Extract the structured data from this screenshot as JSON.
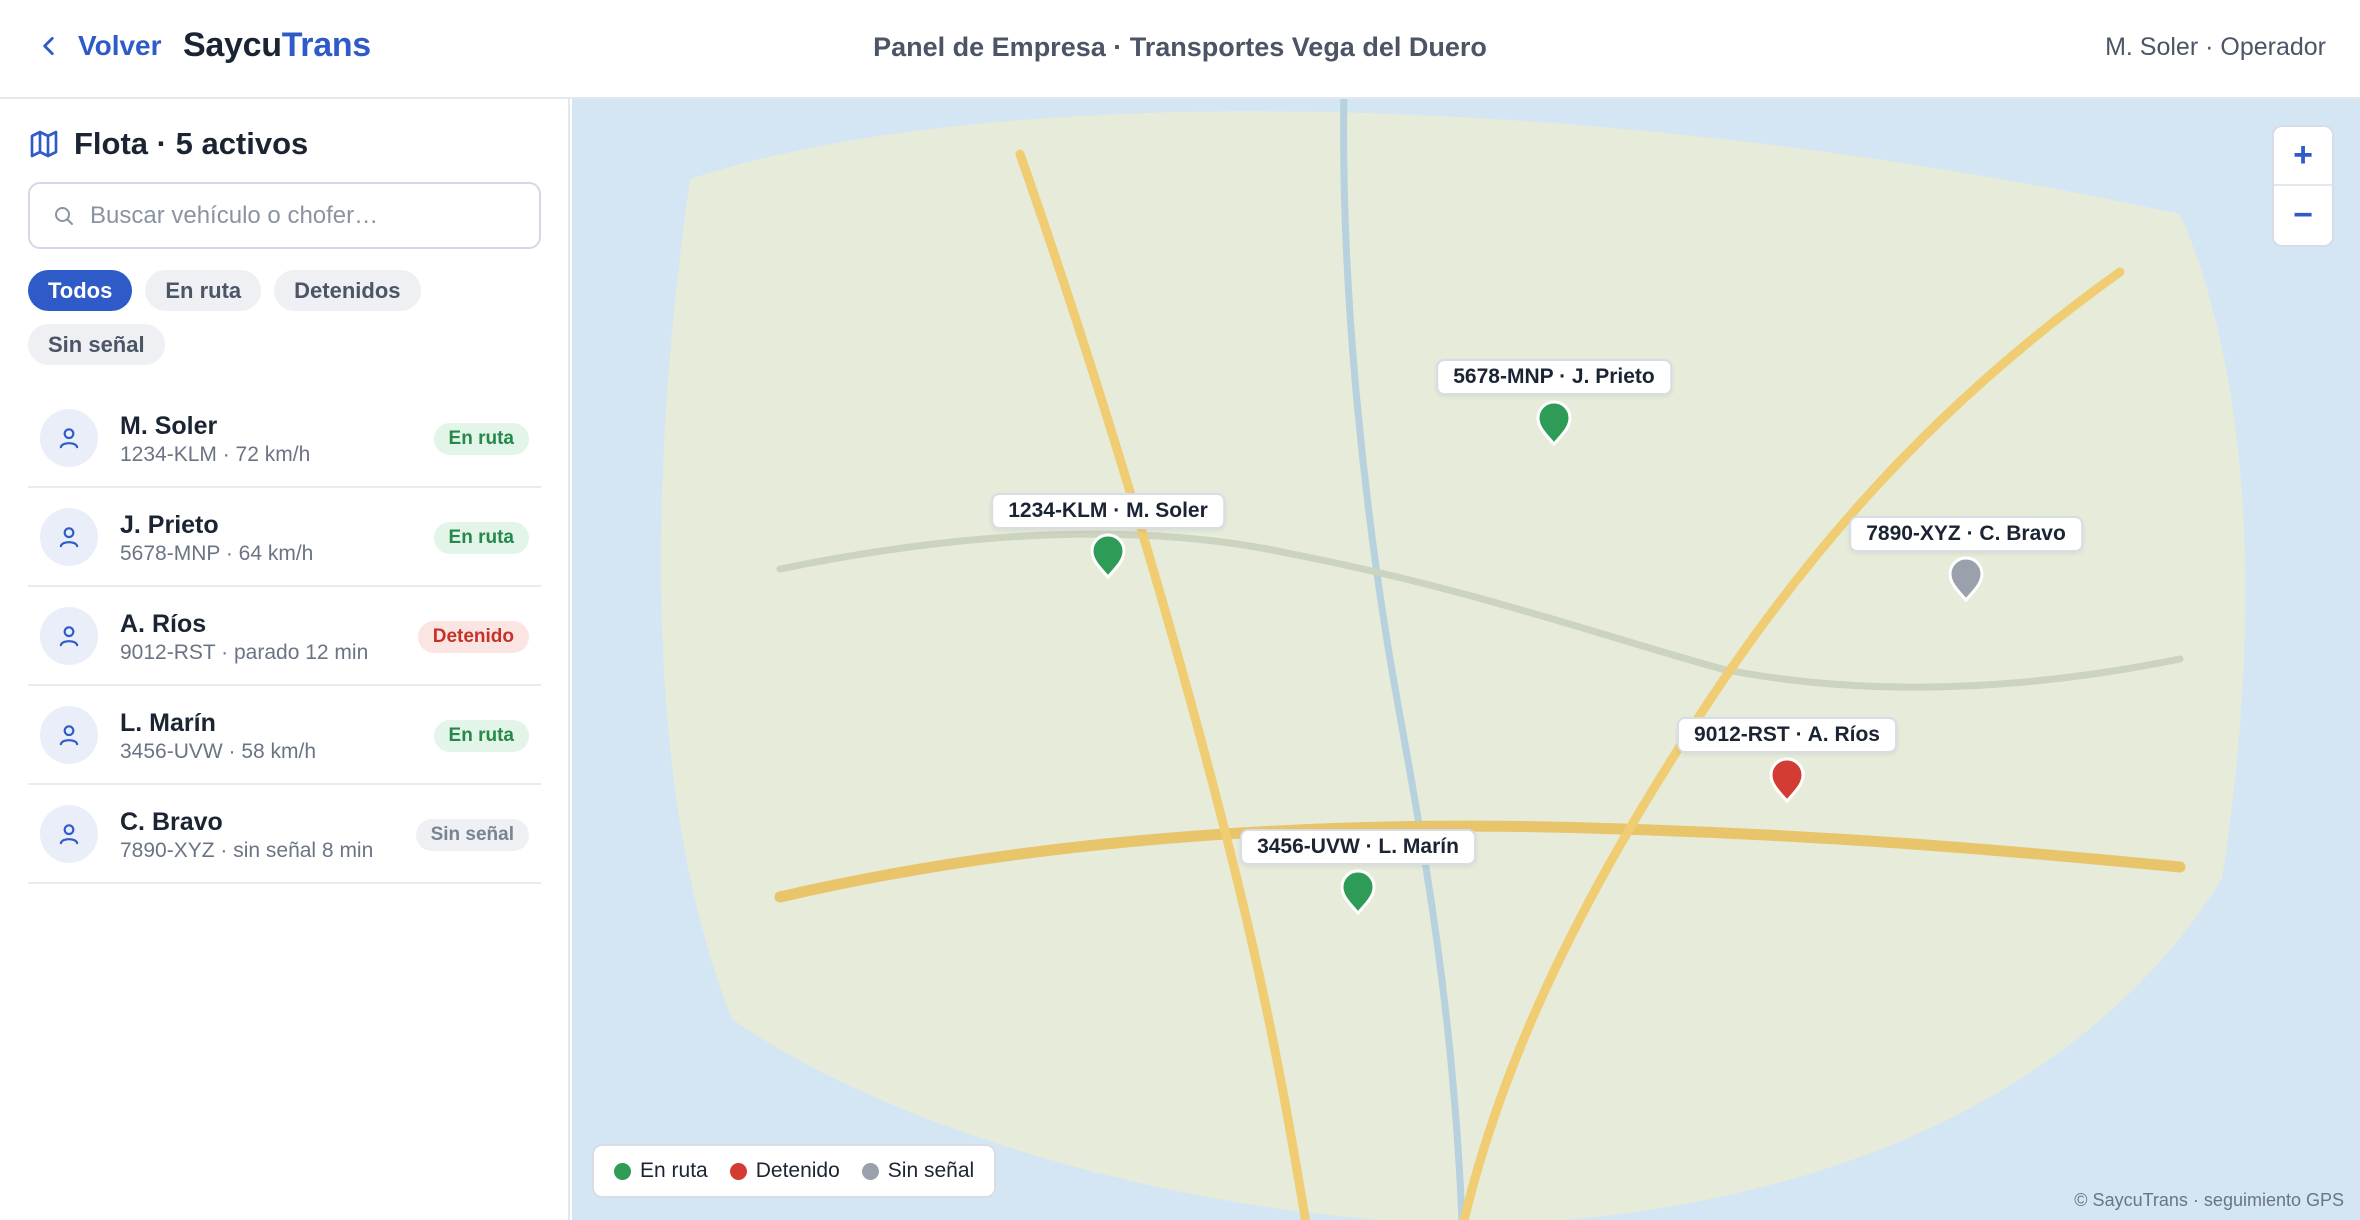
{
  "header": {
    "back_label": "Volver",
    "brand_part1": "Saycu",
    "brand_part2": "Trans",
    "title": "Panel de Empresa · Transportes Vega del Duero",
    "user": "M. Soler · Operador"
  },
  "sidebar": {
    "title": "Flota · 5 activos",
    "search_placeholder": "Buscar vehículo o chofer…",
    "filters": [
      {
        "label": "Todos",
        "active": true
      },
      {
        "label": "En ruta",
        "active": false
      },
      {
        "label": "Detenidos",
        "active": false
      },
      {
        "label": "Sin señal",
        "active": false
      }
    ],
    "drivers": [
      {
        "name": "M. Soler",
        "detail": "1234-KLM · 72 km/h",
        "status": "En ruta",
        "status_kind": "ok"
      },
      {
        "name": "J. Prieto",
        "detail": "5678-MNP · 64 km/h",
        "status": "En ruta",
        "status_kind": "ok"
      },
      {
        "name": "A. Ríos",
        "detail": "9012-RST · parado 12 min",
        "status": "Detenido",
        "status_kind": "stop"
      },
      {
        "name": "L. Marín",
        "detail": "3456-UVW · 58 km/h",
        "status": "En ruta",
        "status_kind": "ok"
      },
      {
        "name": "C. Bravo",
        "detail": "7890-XYZ · sin señal 8 min",
        "status": "Sin señal",
        "status_kind": "nosig"
      }
    ]
  },
  "map": {
    "markers": [
      {
        "label": "5678-MNP · J. Prieto",
        "status": "ok"
      },
      {
        "label": "1234-KLM · M. Soler",
        "status": "ok"
      },
      {
        "label": "7890-XYZ · C. Bravo",
        "status": "nosig"
      },
      {
        "label": "9012-RST · A. Ríos",
        "status": "stop"
      },
      {
        "label": "3456-UVW · L. Marín",
        "status": "ok"
      }
    ],
    "zoom_in": "+",
    "zoom_out": "−",
    "legend": [
      {
        "label": "En ruta",
        "color": "#2e9b57"
      },
      {
        "label": "Detenido",
        "color": "#d23c33"
      },
      {
        "label": "Sin señal",
        "color": "#9aa1ad"
      }
    ],
    "copyright": "© SaycuTrans · seguimiento GPS"
  },
  "colors": {
    "accent": "#2f5bc9",
    "ok": "#2e9b57",
    "stop": "#d23c33",
    "nosig": "#9aa1ad",
    "land": "#e6ebda",
    "water": "#d4e6f3"
  }
}
